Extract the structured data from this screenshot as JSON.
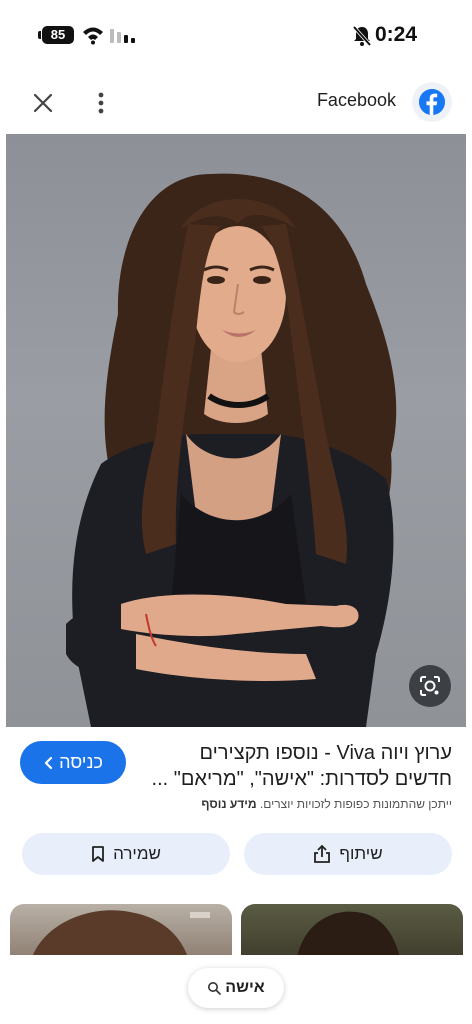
{
  "status_bar": {
    "battery": "85",
    "time": "0:24"
  },
  "header": {
    "source": "Facebook"
  },
  "result": {
    "title_line1": "ערוץ ויוה Viva - נוספו תקצירים",
    "title_line2": "חדשים לסדרות: \"אישה\", \"מריאם\" ...",
    "visit_label": "כניסה",
    "notice_text": "ייתכן שהתמונות כפופות לזכויות יוצרים.",
    "learn_more": "מידע נוסף"
  },
  "actions": {
    "share_label": "שיתוף",
    "save_label": "שמירה"
  },
  "search_chip": {
    "query": "אישה"
  }
}
